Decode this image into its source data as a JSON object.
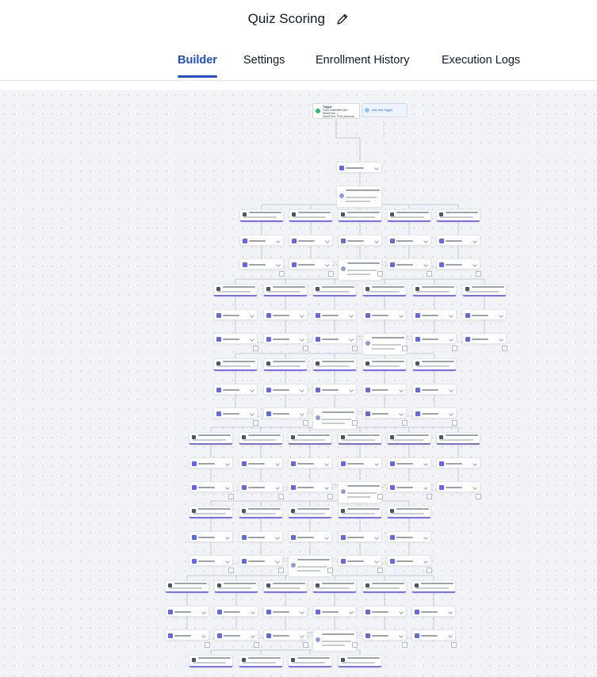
{
  "header": {
    "title": "Quiz Scoring",
    "edit_icon": "pencil-icon"
  },
  "tabs": [
    {
      "label": "Builder",
      "active": true
    },
    {
      "label": "Settings",
      "active": false
    },
    {
      "label": "Enrollment History",
      "active": false
    },
    {
      "label": "Execution Logs",
      "active": false
    }
  ],
  "colors": {
    "accent": "#1d4ed8",
    "branch_border": "#7c6cf0",
    "canvas_bg": "#f1f3f6"
  },
  "canvas": {
    "trigger_card": {
      "title": "Trigger",
      "subtitle": "Form Submitted (for WorkFlow...)",
      "detail": "Quiz/Form: Free personal"
    },
    "add_trigger_label": "Add New Trigger",
    "tag_action_label": "Apply Workflow Action: Tag"
  }
}
